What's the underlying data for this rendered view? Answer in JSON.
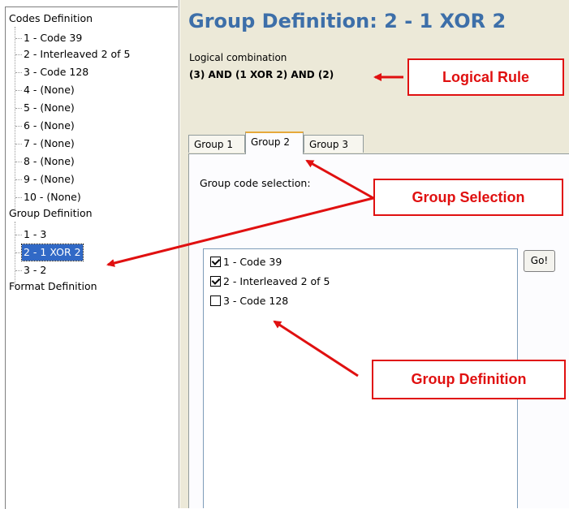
{
  "tree": {
    "codes_root": "Codes Definition",
    "codes": [
      "1 - Code 39",
      "2 - Interleaved 2 of 5",
      "3 - Code 128",
      "4 - (None)",
      "5 - (None)",
      "6 - (None)",
      "7 - (None)",
      "8 - (None)",
      "9 - (None)",
      "10 - (None)"
    ],
    "group_root": "Group Definition",
    "groups": [
      "1 - 3",
      "2 - 1 XOR 2",
      "3 - 2"
    ],
    "format_root": "Format Definition",
    "selected_group": "2 - 1 XOR 2"
  },
  "panel": {
    "title": "Group Definition: 2 - 1 XOR 2",
    "logical_label": "Logical combination",
    "logical_value": "(3) AND (1 XOR 2) AND (2)",
    "tabs": [
      "Group 1",
      "Group 2",
      "Group 3"
    ],
    "active_tab": "Group 2",
    "selection_label": "Group code selection:",
    "list": [
      {
        "label": "1 - Code 39",
        "checked": true
      },
      {
        "label": "2 - Interleaved 2 of 5",
        "checked": true
      },
      {
        "label": "3 - Code 128",
        "checked": false
      }
    ],
    "go_label": "Go!"
  },
  "callouts": {
    "logical_rule": "Logical Rule",
    "group_selection": "Group Selection",
    "group_definition": "Group Definition"
  },
  "colors": {
    "accent_title": "#3d6fa9",
    "selection": "#3169c6",
    "callout": "#e01010"
  }
}
